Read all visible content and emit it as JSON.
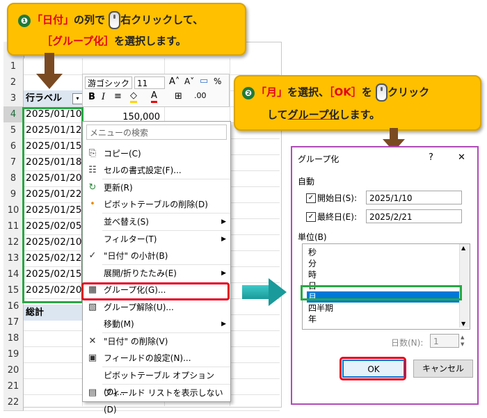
{
  "callout1": {
    "number": "❶",
    "line1_a": "「日付」",
    "line1_b": "の列で",
    "line1_c": "右クリック",
    "line1_d": "して、",
    "line2_a": "［グループ化］",
    "line2_b": "を選択します。"
  },
  "callout2": {
    "number": "❷",
    "line1_a": "「月」",
    "line1_b": "を選択、",
    "line1_c": "［OK］",
    "line1_d": "を",
    "line1_e": "クリック",
    "line2_a": "して",
    "line2_b": "グループ化",
    "line2_c": "します。"
  },
  "sheet": {
    "rows": [
      "1",
      "2",
      "3",
      "4",
      "5",
      "6",
      "7",
      "8",
      "9",
      "10",
      "11",
      "12",
      "13",
      "14",
      "15",
      "16",
      "17",
      "18",
      "19",
      "20",
      "21",
      "22"
    ],
    "header_label": "行ラベル",
    "dates": [
      "2025/01/10",
      "2025/01/12",
      "2025/01/15",
      "2025/01/18",
      "2025/01/20",
      "2025/01/22",
      "2025/01/25",
      "2025/02/05",
      "2025/02/10",
      "2025/02/12",
      "2025/02/15",
      "2025/02/20"
    ],
    "total_label": "総計",
    "value_cell": "150,000"
  },
  "mini_toolbar": {
    "font": "游ゴシック",
    "size": "11",
    "bold": "B",
    "italic": "I",
    "percent": "%",
    "comma": ","
  },
  "context_menu": {
    "search_placeholder": "メニューの検索",
    "items": [
      "コピー(C)",
      "セルの書式設定(F)...",
      "更新(R)",
      "ピボットテーブルの削除(D)",
      "並べ替え(S)",
      "フィルター(T)",
      "\"日付\" の小計(B)",
      "展開/折りたたみ(E)",
      "グループ化(G)...",
      "グループ解除(U)...",
      "移動(M)",
      "\"日付\" の削除(V)",
      "フィールドの設定(N)...",
      "ピボットテーブル オプション(O)...",
      "フィールド リストを表示しない(D)"
    ]
  },
  "dialog": {
    "title": "グループ化",
    "help": "?",
    "close": "✕",
    "auto_label": "自動",
    "start_label": "開始日(S):",
    "start_value": "2025/1/10",
    "end_label": "最終日(E):",
    "end_value": "2025/2/21",
    "unit_label": "単位(B)",
    "units": [
      "秒",
      "分",
      "時",
      "日",
      "月",
      "四半期",
      "年"
    ],
    "selected_unit": "月",
    "days_label": "日数(N):",
    "days_value": "1",
    "ok": "OK",
    "cancel": "キャンセル"
  },
  "colors": {
    "callout": "#ffc000",
    "green_box": "#27a844",
    "red_box": "#e3001b",
    "selection": "#0078d7",
    "dialog_border": "#b04ab8"
  }
}
